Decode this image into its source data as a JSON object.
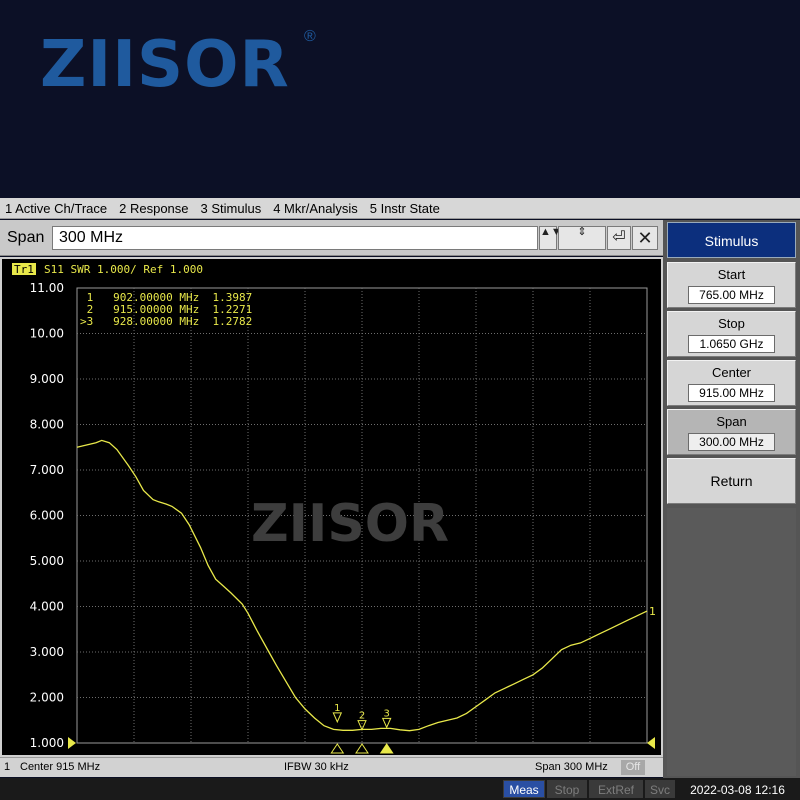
{
  "brand": {
    "name": "ZIISOR",
    "registered": "®"
  },
  "menu": {
    "items": [
      {
        "label": "1 Active Ch/Trace"
      },
      {
        "label": "2 Response"
      },
      {
        "label": "3 Stimulus"
      },
      {
        "label": "4 Mkr/Analysis"
      },
      {
        "label": "5 Instr State"
      }
    ]
  },
  "entry": {
    "label": "Span",
    "value": "300 MHz",
    "buttons": {
      "spin": "▲▼",
      "step": "⇕",
      "enter": "⏎",
      "cancel": "✕"
    }
  },
  "trace": {
    "tag": "Tr1",
    "header": "S11  SWR 1.000/ Ref 1.000"
  },
  "markers_table": [
    {
      "text": " 1   902.00000 MHz  1.3987"
    },
    {
      "text": " 2   915.00000 MHz  1.2271"
    },
    {
      "text": ">3   928.00000 MHz  1.2782"
    }
  ],
  "watermark": "ZIISOR",
  "colors": {
    "trace": "#e8e84a",
    "grid": "#8a8a8a",
    "text": "#ffffff",
    "tag_bg": "#e8e84a"
  },
  "chart_data": {
    "type": "line",
    "xlim": [
      765,
      1065
    ],
    "ylim": [
      1.0,
      11.0
    ],
    "yticks": [
      "11.00",
      "10.00",
      "9.000",
      "8.000",
      "7.000",
      "6.000",
      "5.000",
      "4.000",
      "3.000",
      "2.000",
      "1.000"
    ],
    "series": [
      {
        "x": [
          765,
          770,
          775,
          778,
          782,
          786,
          792,
          796,
          800,
          805,
          808,
          812,
          815,
          820,
          824,
          830,
          834,
          838,
          842,
          846,
          852,
          855,
          860,
          866,
          870,
          875,
          880,
          885,
          890,
          895,
          900,
          905,
          910,
          915,
          920,
          925,
          930,
          935,
          940,
          945,
          950,
          955,
          960,
          965,
          970,
          975,
          980,
          985,
          990,
          995,
          1000,
          1005,
          1010,
          1015,
          1020,
          1025,
          1030,
          1035,
          1040,
          1045,
          1050,
          1055,
          1060,
          1065
        ],
        "y": [
          7.5,
          7.55,
          7.6,
          7.65,
          7.6,
          7.45,
          7.1,
          6.85,
          6.55,
          6.35,
          6.3,
          6.25,
          6.2,
          6.05,
          5.8,
          5.3,
          4.9,
          4.6,
          4.45,
          4.3,
          4.05,
          3.85,
          3.45,
          3.0,
          2.7,
          2.35,
          2.0,
          1.75,
          1.55,
          1.38,
          1.3,
          1.28,
          1.28,
          1.3,
          1.3,
          1.32,
          1.32,
          1.29,
          1.27,
          1.3,
          1.38,
          1.45,
          1.5,
          1.55,
          1.65,
          1.8,
          1.95,
          2.1,
          2.2,
          2.3,
          2.4,
          2.5,
          2.65,
          2.85,
          3.05,
          3.15,
          3.2,
          3.3,
          3.4,
          3.5,
          3.6,
          3.7,
          3.8,
          3.9
        ]
      }
    ],
    "markers": [
      {
        "id": "1",
        "x": 902.0,
        "y": 1.3987
      },
      {
        "id": "2",
        "x": 915.0,
        "y": 1.2271
      },
      {
        "id": "3",
        "x": 928.0,
        "y": 1.2782,
        "active": true
      }
    ],
    "end_marker_label": "1"
  },
  "status": {
    "channel": "1",
    "center": "Center 915 MHz",
    "ifbw": "IFBW 30 kHz",
    "span": "Span 300 MHz",
    "off": "Off"
  },
  "instr": {
    "meas": "Meas",
    "stop": "Stop",
    "extref": "ExtRef",
    "svc": "Svc",
    "datetime": "2022-03-08 12:16"
  },
  "softkeys": {
    "title": "Stimulus",
    "start": {
      "label": "Start",
      "value": "765.00 MHz"
    },
    "stop": {
      "label": "Stop",
      "value": "1.0650 GHz"
    },
    "center": {
      "label": "Center",
      "value": "915.00 MHz"
    },
    "span": {
      "label": "Span",
      "value": "300.00 MHz"
    },
    "return": "Return"
  }
}
